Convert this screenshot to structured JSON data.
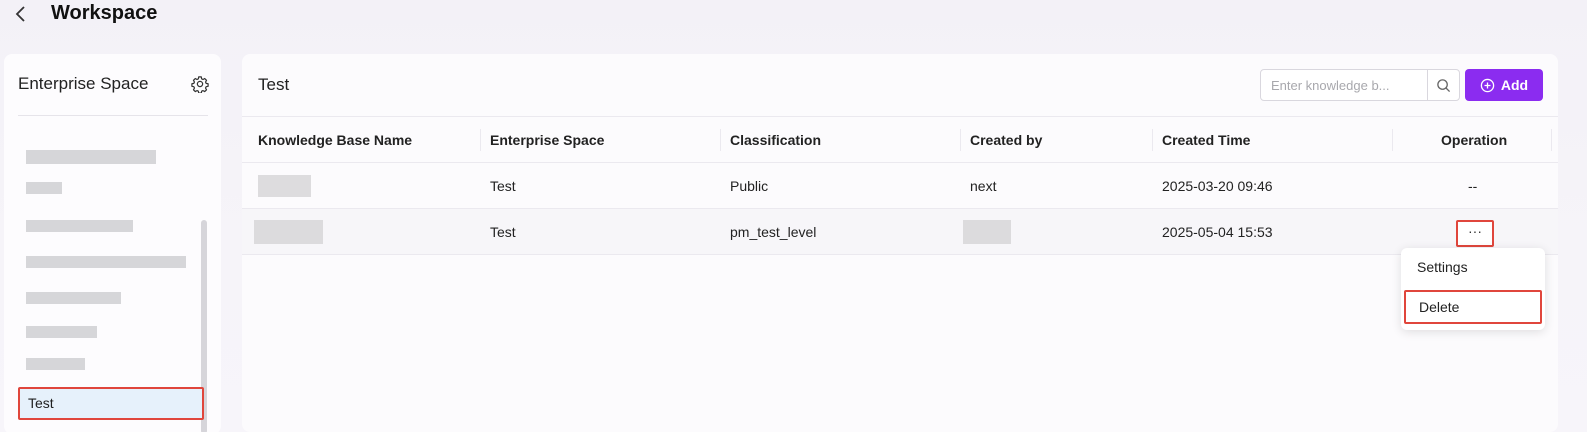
{
  "header": {
    "title": "Workspace",
    "back_icon": "chevron-left-icon"
  },
  "sidebar": {
    "title": "Enterprise Space",
    "settings_icon": "gear-icon",
    "selected_item": "Test"
  },
  "main": {
    "title": "Test",
    "search": {
      "placeholder": "Enter knowledge b...",
      "icon": "search-icon"
    },
    "add_button": {
      "label": "Add",
      "icon": "plus-circle-icon"
    },
    "columns": [
      "Knowledge Base Name",
      "Enterprise Space",
      "Classification",
      "Created by",
      "Created Time",
      "Operation"
    ],
    "rows": [
      {
        "enterprise_space": "Test",
        "classification": "Public",
        "created_by": "next",
        "created_time": "2025-03-20 09:46",
        "operation": "--"
      },
      {
        "enterprise_space": "Test",
        "classification": "pm_test_level",
        "created_by": "",
        "created_time": "2025-05-04 15:53",
        "operation": "···"
      }
    ],
    "menu": {
      "settings": "Settings",
      "delete": "Delete"
    }
  },
  "colors": {
    "accent": "#8b2cf0",
    "highlight": "#e0463c",
    "selected_bg": "#e6f1fb"
  }
}
